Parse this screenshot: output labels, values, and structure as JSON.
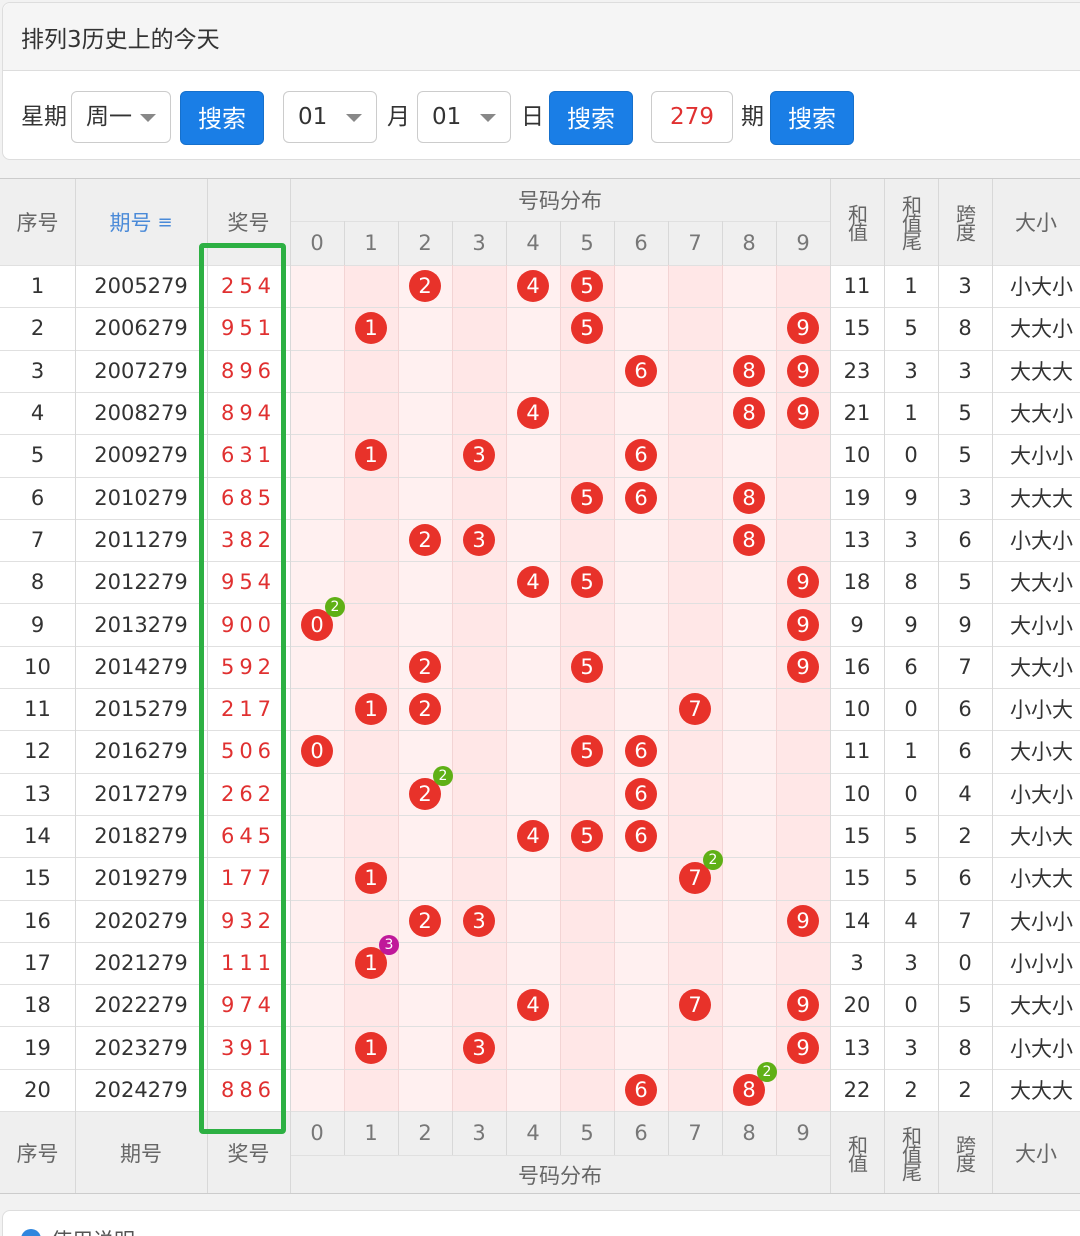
{
  "panel": {
    "title": "排列3历史上的今天"
  },
  "search": {
    "weekday_label": "星期",
    "weekday_value": "周一",
    "month_value": "01",
    "month_label": "月",
    "day_value": "01",
    "day_label": "日",
    "issue_value": "279",
    "issue_label": "期",
    "search_label": "搜索"
  },
  "table": {
    "headers": {
      "seq": "序号",
      "issue": "期号",
      "prize": "奖号",
      "distribution": "号码分布",
      "sum": "和值",
      "sum_tail": "和值尾",
      "span": "跨度",
      "size": "大小"
    },
    "digits": [
      "0",
      "1",
      "2",
      "3",
      "4",
      "5",
      "6",
      "7",
      "8",
      "9"
    ],
    "rows": [
      {
        "seq": "1",
        "issue": "2005279",
        "prize": "254",
        "balls": [
          2,
          4,
          5
        ],
        "badge": null,
        "sum": "11",
        "tail": "1",
        "span": "3",
        "size": "小大小"
      },
      {
        "seq": "2",
        "issue": "2006279",
        "prize": "951",
        "balls": [
          1,
          5,
          9
        ],
        "badge": null,
        "sum": "15",
        "tail": "5",
        "span": "8",
        "size": "大大小"
      },
      {
        "seq": "3",
        "issue": "2007279",
        "prize": "896",
        "balls": [
          6,
          8,
          9
        ],
        "badge": null,
        "sum": "23",
        "tail": "3",
        "span": "3",
        "size": "大大大"
      },
      {
        "seq": "4",
        "issue": "2008279",
        "prize": "894",
        "balls": [
          4,
          8,
          9
        ],
        "badge": null,
        "sum": "21",
        "tail": "1",
        "span": "5",
        "size": "大大小"
      },
      {
        "seq": "5",
        "issue": "2009279",
        "prize": "631",
        "balls": [
          1,
          3,
          6
        ],
        "badge": null,
        "sum": "10",
        "tail": "0",
        "span": "5",
        "size": "大小小"
      },
      {
        "seq": "6",
        "issue": "2010279",
        "prize": "685",
        "balls": [
          5,
          6,
          8
        ],
        "badge": null,
        "sum": "19",
        "tail": "9",
        "span": "3",
        "size": "大大大"
      },
      {
        "seq": "7",
        "issue": "2011279",
        "prize": "382",
        "balls": [
          2,
          3,
          8
        ],
        "badge": null,
        "sum": "13",
        "tail": "3",
        "span": "6",
        "size": "小大小"
      },
      {
        "seq": "8",
        "issue": "2012279",
        "prize": "954",
        "balls": [
          4,
          5,
          9
        ],
        "badge": null,
        "sum": "18",
        "tail": "8",
        "span": "5",
        "size": "大大小"
      },
      {
        "seq": "9",
        "issue": "2013279",
        "prize": "900",
        "balls": [
          0,
          9
        ],
        "badge": {
          "digit": 0,
          "count": "2",
          "color": "#5fb016"
        },
        "sum": "9",
        "tail": "9",
        "span": "9",
        "size": "大小小"
      },
      {
        "seq": "10",
        "issue": "2014279",
        "prize": "592",
        "balls": [
          2,
          5,
          9
        ],
        "badge": null,
        "sum": "16",
        "tail": "6",
        "span": "7",
        "size": "大大小"
      },
      {
        "seq": "11",
        "issue": "2015279",
        "prize": "217",
        "balls": [
          1,
          2,
          7
        ],
        "badge": null,
        "sum": "10",
        "tail": "0",
        "span": "6",
        "size": "小小大"
      },
      {
        "seq": "12",
        "issue": "2016279",
        "prize": "506",
        "balls": [
          0,
          5,
          6
        ],
        "badge": null,
        "sum": "11",
        "tail": "1",
        "span": "6",
        "size": "大小大"
      },
      {
        "seq": "13",
        "issue": "2017279",
        "prize": "262",
        "balls": [
          2,
          6
        ],
        "badge": {
          "digit": 2,
          "count": "2",
          "color": "#5fb016"
        },
        "sum": "10",
        "tail": "0",
        "span": "4",
        "size": "小大小"
      },
      {
        "seq": "14",
        "issue": "2018279",
        "prize": "645",
        "balls": [
          4,
          5,
          6
        ],
        "badge": null,
        "sum": "15",
        "tail": "5",
        "span": "2",
        "size": "大小大"
      },
      {
        "seq": "15",
        "issue": "2019279",
        "prize": "177",
        "balls": [
          1,
          7
        ],
        "badge": {
          "digit": 7,
          "count": "2",
          "color": "#5fb016"
        },
        "sum": "15",
        "tail": "5",
        "span": "6",
        "size": "小大大"
      },
      {
        "seq": "16",
        "issue": "2020279",
        "prize": "932",
        "balls": [
          2,
          3,
          9
        ],
        "badge": null,
        "sum": "14",
        "tail": "4",
        "span": "7",
        "size": "大小小"
      },
      {
        "seq": "17",
        "issue": "2021279",
        "prize": "111",
        "balls": [
          1
        ],
        "badge": {
          "digit": 1,
          "count": "3",
          "color": "#c0189a"
        },
        "sum": "3",
        "tail": "3",
        "span": "0",
        "size": "小小小"
      },
      {
        "seq": "18",
        "issue": "2022279",
        "prize": "974",
        "balls": [
          4,
          7,
          9
        ],
        "badge": null,
        "sum": "20",
        "tail": "0",
        "span": "5",
        "size": "大大小"
      },
      {
        "seq": "19",
        "issue": "2023279",
        "prize": "391",
        "balls": [
          1,
          3,
          9
        ],
        "badge": null,
        "sum": "13",
        "tail": "3",
        "span": "8",
        "size": "小大小"
      },
      {
        "seq": "20",
        "issue": "2024279",
        "prize": "886",
        "balls": [
          6,
          8
        ],
        "badge": {
          "digit": 8,
          "count": "2",
          "color": "#5fb016"
        },
        "sum": "22",
        "tail": "2",
        "span": "2",
        "size": "大大大"
      }
    ]
  },
  "footer": {
    "usage_label": "使用说明"
  },
  "colors": {
    "ball": "#e8322a",
    "accent": "#1a7ee6",
    "highlight": "#2db043",
    "prize_text": "#e03030"
  }
}
